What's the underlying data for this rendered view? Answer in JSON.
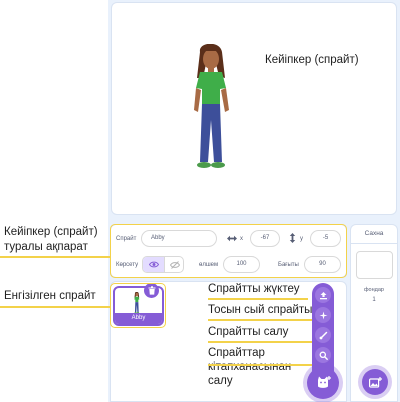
{
  "colors": {
    "accent": "#855cd6",
    "highlight": "#f3d24a",
    "background": "#e9f1fc"
  },
  "stage": {
    "label": "Кейіпкер (спрайт)"
  },
  "annotations": {
    "sprite_info_line1": "Кейіпкер (спрайт)",
    "sprite_info_line2": "туралы ақпарат",
    "inserted_sprite": "Енгізілген спрайт"
  },
  "sprite_info": {
    "sprite_label": "Спрайт",
    "sprite_name": "Abby",
    "x_icon": "horizontal-arrows-icon",
    "x_label": "x",
    "x_value": "-67",
    "y_icon": "vertical-arrows-icon",
    "y_label": "y",
    "y_value": "-5",
    "show_label": "Көрсету",
    "size_label": "өлшем",
    "size_value": "100",
    "direction_label": "Бағыты",
    "direction_value": "90"
  },
  "sprite_list": {
    "items": [
      {
        "name": "Abby",
        "selected": true
      }
    ]
  },
  "sprite_menu": {
    "items": [
      {
        "label": "Спрайтты жүктеу",
        "icon": "upload-icon"
      },
      {
        "label": "Тосын сый спрайты",
        "icon": "sparkle-icon"
      },
      {
        "label": "Спрайтты салу",
        "icon": "paintbrush-icon"
      },
      {
        "label": "Спрайттар",
        "icon": "search-icon"
      }
    ],
    "library_line2": "кітапханасынан",
    "library_line3": "салу",
    "main_icon": "cat-plus-icon"
  },
  "stage_panel": {
    "title": "Сахна",
    "backdrops_label": "фондар",
    "backdrops_count": "1",
    "backdrop_icon": "image-plus-icon"
  }
}
